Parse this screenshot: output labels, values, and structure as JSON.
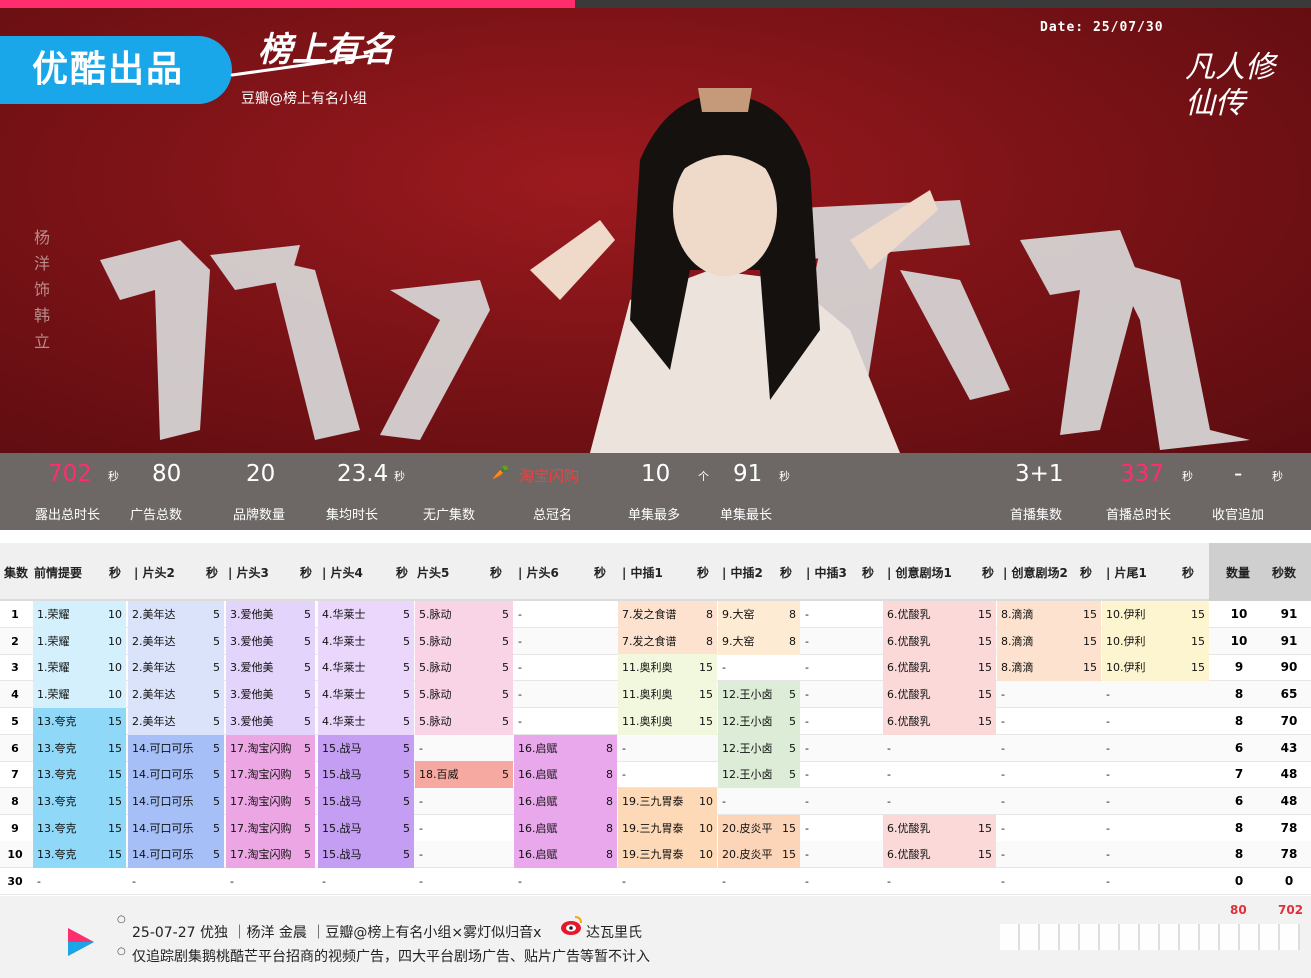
{
  "banner": {
    "badge": "优酷出品",
    "brand": "榜上有名",
    "douban": "豆瓣@榜上有名小组",
    "date": "Date: 25/07/30",
    "drama_logo": "凡人修仙传",
    "actor_credit": "杨洋饰韩立",
    "calligraphy": "凡人不凡"
  },
  "stats": [
    {
      "value": "702",
      "unit": "秒",
      "label": "露出总时长",
      "pink": true
    },
    {
      "value": "80",
      "unit": "",
      "label": "广告总数"
    },
    {
      "value": "20",
      "unit": "",
      "label": "品牌数量"
    },
    {
      "value": "23.4",
      "unit": "秒",
      "label": "集均时长"
    },
    {
      "value": "",
      "unit": "",
      "label": "无广集数"
    },
    {
      "value": "淘宝闪购",
      "unit": "",
      "label": "总冠名"
    },
    {
      "value": "10",
      "unit": "个",
      "label": "单集最多"
    },
    {
      "value": "91",
      "unit": "秒",
      "label": "单集最长"
    },
    {
      "value": "3+1",
      "unit": "",
      "label": "首播集数"
    },
    {
      "value": "337",
      "unit": "秒",
      "label": "首播总时长",
      "pink": true
    },
    {
      "value": "-",
      "unit": "秒",
      "label": "收官追加"
    }
  ],
  "table": {
    "headers": [
      "集数",
      "前情提要",
      "秒",
      "| 片头2",
      "秒",
      "| 片头3",
      "秒",
      "| 片头4",
      "秒",
      "片头5",
      "秒",
      "| 片头6",
      "秒",
      "| 中插1",
      "秒",
      "| 中插2",
      "秒",
      "| 中插3",
      "秒",
      "| 创意剧场1",
      "秒",
      "| 创意剧场2",
      "秒",
      "| 片尾1",
      "秒",
      "数量",
      "秒数"
    ],
    "rows": [
      {
        "ep": "1",
        "cells": [
          [
            "1.荣耀",
            "10"
          ],
          [
            "2.美年达",
            "5"
          ],
          [
            "3.爱他美",
            "5"
          ],
          [
            "4.华莱士",
            "5"
          ],
          [
            "5.脉动",
            "5"
          ],
          [
            "-",
            ""
          ],
          [
            "7.发之食谱",
            "8"
          ],
          [
            "9.大窑",
            "8"
          ],
          [
            "-",
            ""
          ],
          [
            "6.优酸乳",
            "15"
          ],
          [
            "8.滴滴",
            "15"
          ],
          [
            "10.伊利",
            "15"
          ]
        ],
        "count": "10",
        "secs": "91"
      },
      {
        "ep": "2",
        "cells": [
          [
            "1.荣耀",
            "10"
          ],
          [
            "2.美年达",
            "5"
          ],
          [
            "3.爱他美",
            "5"
          ],
          [
            "4.华莱士",
            "5"
          ],
          [
            "5.脉动",
            "5"
          ],
          [
            "-",
            ""
          ],
          [
            "7.发之食谱",
            "8"
          ],
          [
            "9.大窑",
            "8"
          ],
          [
            "-",
            ""
          ],
          [
            "6.优酸乳",
            "15"
          ],
          [
            "8.滴滴",
            "15"
          ],
          [
            "10.伊利",
            "15"
          ]
        ],
        "count": "10",
        "secs": "91"
      },
      {
        "ep": "3",
        "cells": [
          [
            "1.荣耀",
            "10"
          ],
          [
            "2.美年达",
            "5"
          ],
          [
            "3.爱他美",
            "5"
          ],
          [
            "4.华莱士",
            "5"
          ],
          [
            "5.脉动",
            "5"
          ],
          [
            "-",
            ""
          ],
          [
            "11.奥利奥",
            "15"
          ],
          [
            "-",
            ""
          ],
          [
            "-",
            ""
          ],
          [
            "6.优酸乳",
            "15"
          ],
          [
            "8.滴滴",
            "15"
          ],
          [
            "10.伊利",
            "15"
          ]
        ],
        "count": "9",
        "secs": "90"
      },
      {
        "ep": "4",
        "cells": [
          [
            "1.荣耀",
            "10"
          ],
          [
            "2.美年达",
            "5"
          ],
          [
            "3.爱他美",
            "5"
          ],
          [
            "4.华莱士",
            "5"
          ],
          [
            "5.脉动",
            "5"
          ],
          [
            "-",
            ""
          ],
          [
            "11.奥利奥",
            "15"
          ],
          [
            "12.王小卤",
            "5"
          ],
          [
            "-",
            ""
          ],
          [
            "6.优酸乳",
            "15"
          ],
          [
            "-",
            ""
          ],
          [
            "-",
            ""
          ]
        ],
        "count": "8",
        "secs": "65"
      },
      {
        "ep": "5",
        "cells": [
          [
            "13.夸克",
            "15"
          ],
          [
            "2.美年达",
            "5"
          ],
          [
            "3.爱他美",
            "5"
          ],
          [
            "4.华莱士",
            "5"
          ],
          [
            "5.脉动",
            "5"
          ],
          [
            "-",
            ""
          ],
          [
            "11.奥利奥",
            "15"
          ],
          [
            "12.王小卤",
            "5"
          ],
          [
            "-",
            ""
          ],
          [
            "6.优酸乳",
            "15"
          ],
          [
            "-",
            ""
          ],
          [
            "-",
            ""
          ]
        ],
        "count": "8",
        "secs": "70"
      },
      {
        "ep": "6",
        "cells": [
          [
            "13.夸克",
            "15"
          ],
          [
            "14.可口可乐",
            "5"
          ],
          [
            "17.淘宝闪购",
            "5"
          ],
          [
            "15.战马",
            "5"
          ],
          [
            "-",
            ""
          ],
          [
            "16.启赋",
            "8"
          ],
          [
            "-",
            ""
          ],
          [
            "12.王小卤",
            "5"
          ],
          [
            "-",
            ""
          ],
          [
            "-",
            ""
          ],
          [
            "-",
            ""
          ],
          [
            "-",
            ""
          ]
        ],
        "count": "6",
        "secs": "43"
      },
      {
        "ep": "7",
        "cells": [
          [
            "13.夸克",
            "15"
          ],
          [
            "14.可口可乐",
            "5"
          ],
          [
            "17.淘宝闪购",
            "5"
          ],
          [
            "15.战马",
            "5"
          ],
          [
            "18.百威",
            "5"
          ],
          [
            "16.启赋",
            "8"
          ],
          [
            "-",
            ""
          ],
          [
            "12.王小卤",
            "5"
          ],
          [
            "-",
            ""
          ],
          [
            "-",
            ""
          ],
          [
            "-",
            ""
          ],
          [
            "-",
            ""
          ]
        ],
        "count": "7",
        "secs": "48"
      },
      {
        "ep": "8",
        "cells": [
          [
            "13.夸克",
            "15"
          ],
          [
            "14.可口可乐",
            "5"
          ],
          [
            "17.淘宝闪购",
            "5"
          ],
          [
            "15.战马",
            "5"
          ],
          [
            "-",
            ""
          ],
          [
            "16.启赋",
            "8"
          ],
          [
            "19.三九胃泰",
            "10"
          ],
          [
            "-",
            ""
          ],
          [
            "-",
            ""
          ],
          [
            "-",
            ""
          ],
          [
            "-",
            ""
          ],
          [
            "-",
            ""
          ]
        ],
        "count": "6",
        "secs": "48"
      },
      {
        "ep": "9",
        "cells": [
          [
            "13.夸克",
            "15"
          ],
          [
            "14.可口可乐",
            "5"
          ],
          [
            "17.淘宝闪购",
            "5"
          ],
          [
            "15.战马",
            "5"
          ],
          [
            "-",
            ""
          ],
          [
            "16.启赋",
            "8"
          ],
          [
            "19.三九胃泰",
            "10"
          ],
          [
            "20.皮炎平",
            "15"
          ],
          [
            "-",
            ""
          ],
          [
            "6.优酸乳",
            "15"
          ],
          [
            "-",
            ""
          ],
          [
            "-",
            ""
          ]
        ],
        "count": "8",
        "secs": "78"
      },
      {
        "ep": "10",
        "cells": [
          [
            "13.夸克",
            "15"
          ],
          [
            "14.可口可乐",
            "5"
          ],
          [
            "17.淘宝闪购",
            "5"
          ],
          [
            "15.战马",
            "5"
          ],
          [
            "-",
            ""
          ],
          [
            "16.启赋",
            "8"
          ],
          [
            "19.三九胃泰",
            "10"
          ],
          [
            "20.皮炎平",
            "15"
          ],
          [
            "-",
            ""
          ],
          [
            "6.优酸乳",
            "15"
          ],
          [
            "-",
            ""
          ],
          [
            "-",
            ""
          ]
        ],
        "count": "8",
        "secs": "78"
      },
      {
        "ep": "30",
        "cells": [
          [
            "-",
            ""
          ],
          [
            "-",
            ""
          ],
          [
            "-",
            ""
          ],
          [
            "-",
            ""
          ],
          [
            "-",
            ""
          ],
          [
            "-",
            ""
          ],
          [
            "-",
            ""
          ],
          [
            "-",
            ""
          ],
          [
            "-",
            ""
          ],
          [
            "-",
            ""
          ],
          [
            "-",
            ""
          ],
          [
            "-",
            ""
          ]
        ],
        "count": "0",
        "secs": "0"
      }
    ]
  },
  "brand_colors": {
    "1.荣耀": "#d4f0fc",
    "13.夸克": "#8fd8f7",
    "2.美年达": "#dbe3fb",
    "14.可口可乐": "#a6c0f7",
    "3.爱他美": "#e3d4fb",
    "17.淘宝闪购": "#eba6e3",
    "4.华莱士": "#ead7fb",
    "15.战马": "#c39ef3",
    "5.脉动": "#f8d4e6",
    "18.百威": "#f5a9a0",
    "16.启赋": "#e9a7ec",
    "7.发之食谱": "#fde3cf",
    "11.奥利奥": "#f2f8de",
    "19.三九胃泰": "#fdd9b8",
    "9.大窑": "#fdecd3",
    "12.王小卤": "#dcecd6",
    "20.皮炎平": "#fcd5b9",
    "6.优酸乳": "#fbd9d9",
    "8.滴滴": "#fde3cf",
    "10.伊利": "#fdf5d0"
  },
  "footer": {
    "total_count": "80",
    "total_seconds": "702",
    "line1": "25-07-27  优独  ｜杨洋 金晨 ｜豆瓣@榜上有名小组×雾灯似归音x",
    "line1_tail": "达瓦里氏",
    "line2": "仅追踪剧集鹅桃酷芒平台招商的视频广告，四大平台剧场广告、贴片广告等暂不计入"
  }
}
